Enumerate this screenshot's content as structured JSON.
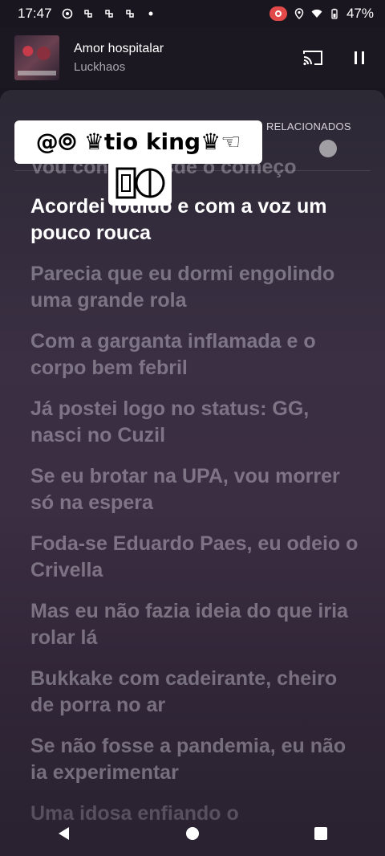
{
  "status_bar": {
    "time": "17:47",
    "battery": "47%"
  },
  "player": {
    "title": "Amor hospitalar",
    "artist": "Luckhaos"
  },
  "tabs": {
    "related": "RELACIONADOS"
  },
  "overlay": {
    "tag_text": "@⦾ ♛tio king♛☜"
  },
  "lyrics": [
    {
      "text": "Vou contar desde o começo",
      "state": "partial"
    },
    {
      "text": "Acordei fodido e com a voz um pouco rouca",
      "state": "active"
    },
    {
      "text": "Parecia que eu dormi engolindo uma grande rola",
      "state": "upcoming"
    },
    {
      "text": "Com a garganta inflamada e o corpo bem febril",
      "state": "upcoming"
    },
    {
      "text": "Já postei logo no status: GG, nasci no Cuzil",
      "state": "upcoming"
    },
    {
      "text": "Se eu brotar na UPA, vou morrer só na espera",
      "state": "upcoming"
    },
    {
      "text": "Foda-se Eduardo Paes, eu odeio o Crivella",
      "state": "upcoming"
    },
    {
      "text": "Mas eu não fazia ideia do que iria rolar lá",
      "state": "upcoming"
    },
    {
      "text": "Bukkake com cadeirante, cheiro de porra no ar",
      "state": "upcoming"
    },
    {
      "text": "Se não fosse a pandemia, eu não ia experimentar",
      "state": "upcoming"
    },
    {
      "text": "Uma idosa enfiando o",
      "state": "fading"
    }
  ],
  "icons": {
    "cast": "cast-icon",
    "pause": "pause-icon",
    "back": "back-icon",
    "home": "home-icon",
    "recents": "recents-icon"
  }
}
